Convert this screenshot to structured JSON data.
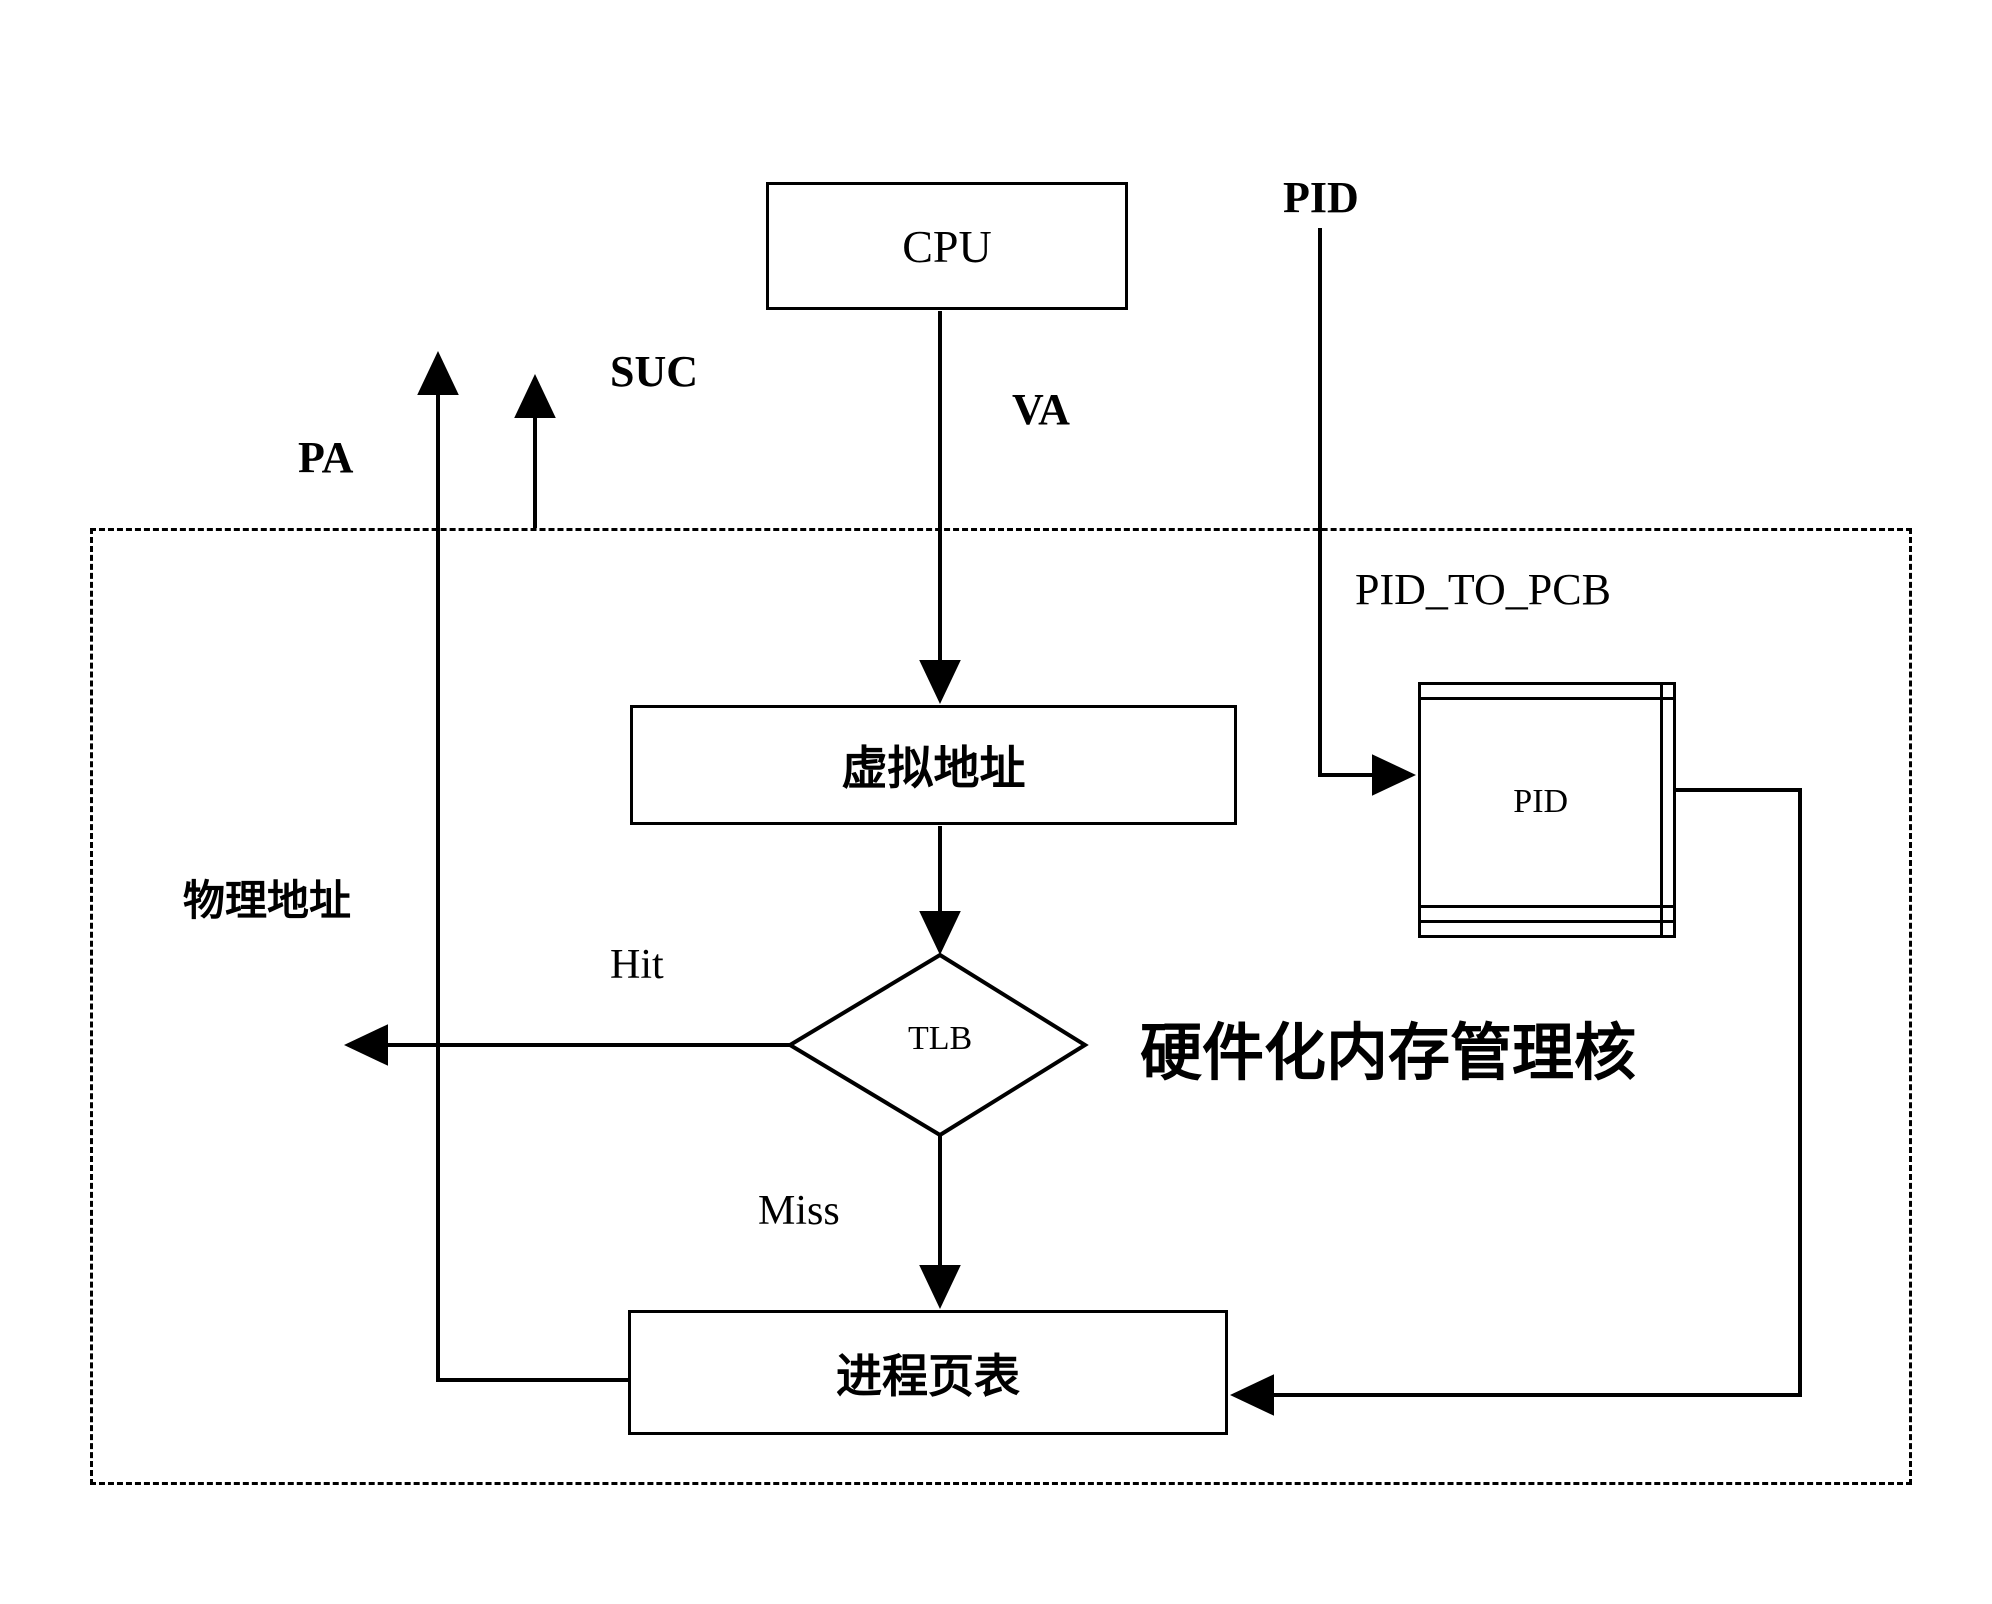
{
  "diagram": {
    "title_text_right": "硬件化内存管理核",
    "nodes": {
      "cpu": "CPU",
      "virtual_address": "虚拟地址",
      "tlb": "TLB",
      "process_page_table": "进程页表"
    },
    "edge_labels": {
      "va": "VA",
      "pa": "PA",
      "suc": "SUC",
      "pid": "PID",
      "hit": "Hit",
      "miss": "Miss",
      "physical_address": "物理地址"
    },
    "table": {
      "caption": "PID_TO_PCB",
      "rows": [
        [
          "",
          ""
        ],
        [
          "PID",
          ""
        ],
        [
          "",
          ""
        ],
        [
          "",
          ""
        ]
      ]
    },
    "boundary": {
      "style": "dashed",
      "label": "硬件化内存管理核"
    },
    "colors": {
      "stroke": "#000000",
      "background": "#ffffff"
    }
  }
}
